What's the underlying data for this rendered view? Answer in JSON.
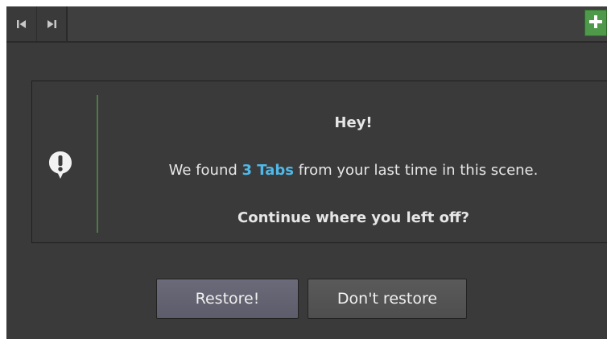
{
  "toolbar": {
    "prev_icon": "skip-to-start-icon",
    "next_icon": "skip-to-end-icon",
    "add_icon": "plus-icon",
    "add_color": "#4e9a4a"
  },
  "notice": {
    "icon": "exclamation-speech-bubble-icon",
    "title": "Hey!",
    "body_prefix": "We found ",
    "tab_count_text": "3 Tabs",
    "body_suffix": " from your last time in this scene.",
    "question": "Continue where you left off?",
    "highlight_color": "#4fb8e8"
  },
  "actions": {
    "restore_label": "Restore!",
    "dont_restore_label": "Don't restore"
  }
}
